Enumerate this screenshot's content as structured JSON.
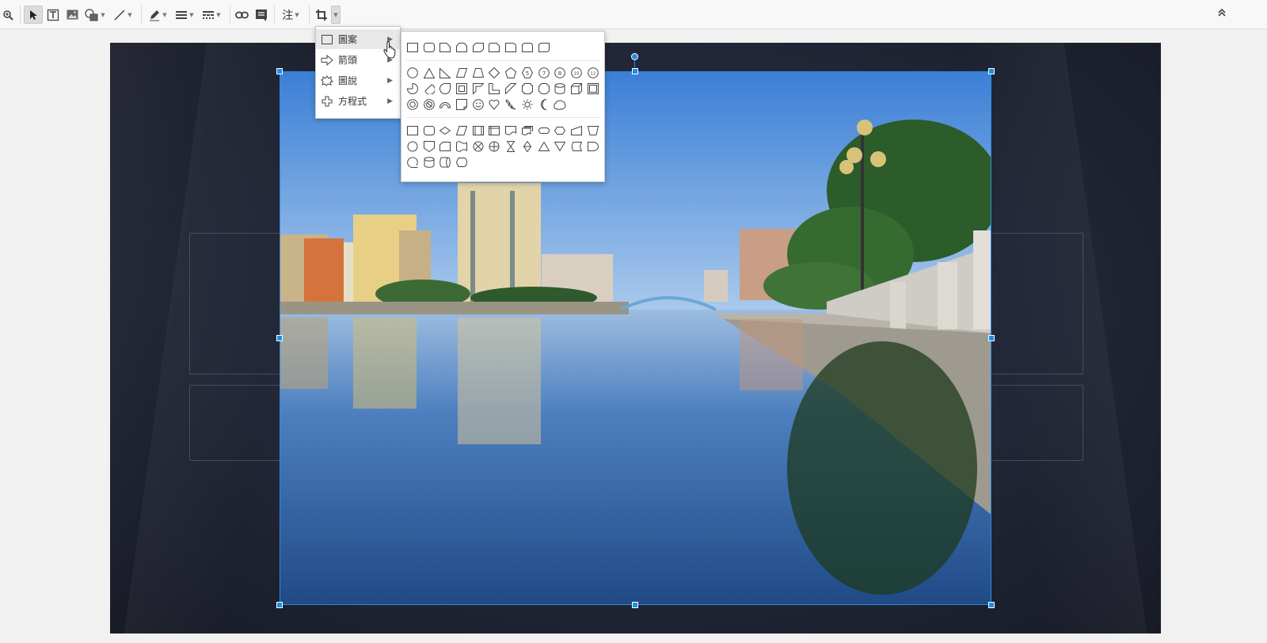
{
  "toolbar": {
    "tools": [
      {
        "id": "zoom",
        "icon": "zoom-icon"
      },
      {
        "id": "select",
        "icon": "cursor-arrow-icon",
        "active": true
      },
      {
        "id": "textbox",
        "icon": "text-box-icon"
      },
      {
        "id": "image",
        "icon": "image-icon"
      },
      {
        "id": "shape",
        "icon": "shape-icon"
      },
      {
        "id": "line",
        "icon": "line-icon"
      },
      {
        "id": "pen",
        "icon": "pen-icon"
      },
      {
        "id": "line-weight",
        "icon": "line-weight-icon"
      },
      {
        "id": "line-dash",
        "icon": "line-dash-icon"
      },
      {
        "id": "link",
        "icon": "link-icon"
      },
      {
        "id": "comment",
        "icon": "comment-icon"
      },
      {
        "id": "crop",
        "icon": "crop-icon"
      }
    ],
    "annotate_label": "注"
  },
  "shape_menu": {
    "items": [
      {
        "label": "圖案",
        "icon": "rectangle-icon"
      },
      {
        "label": "箭頭",
        "icon": "arrow-icon"
      },
      {
        "label": "圖說",
        "icon": "callout-icon"
      },
      {
        "label": "方程式",
        "icon": "plus-icon"
      }
    ],
    "arrow": "▶"
  },
  "colors": {
    "accent": "#1a8fe8",
    "slide_bg": "#1f2331",
    "toolbar_bg": "#f8f8f8"
  }
}
